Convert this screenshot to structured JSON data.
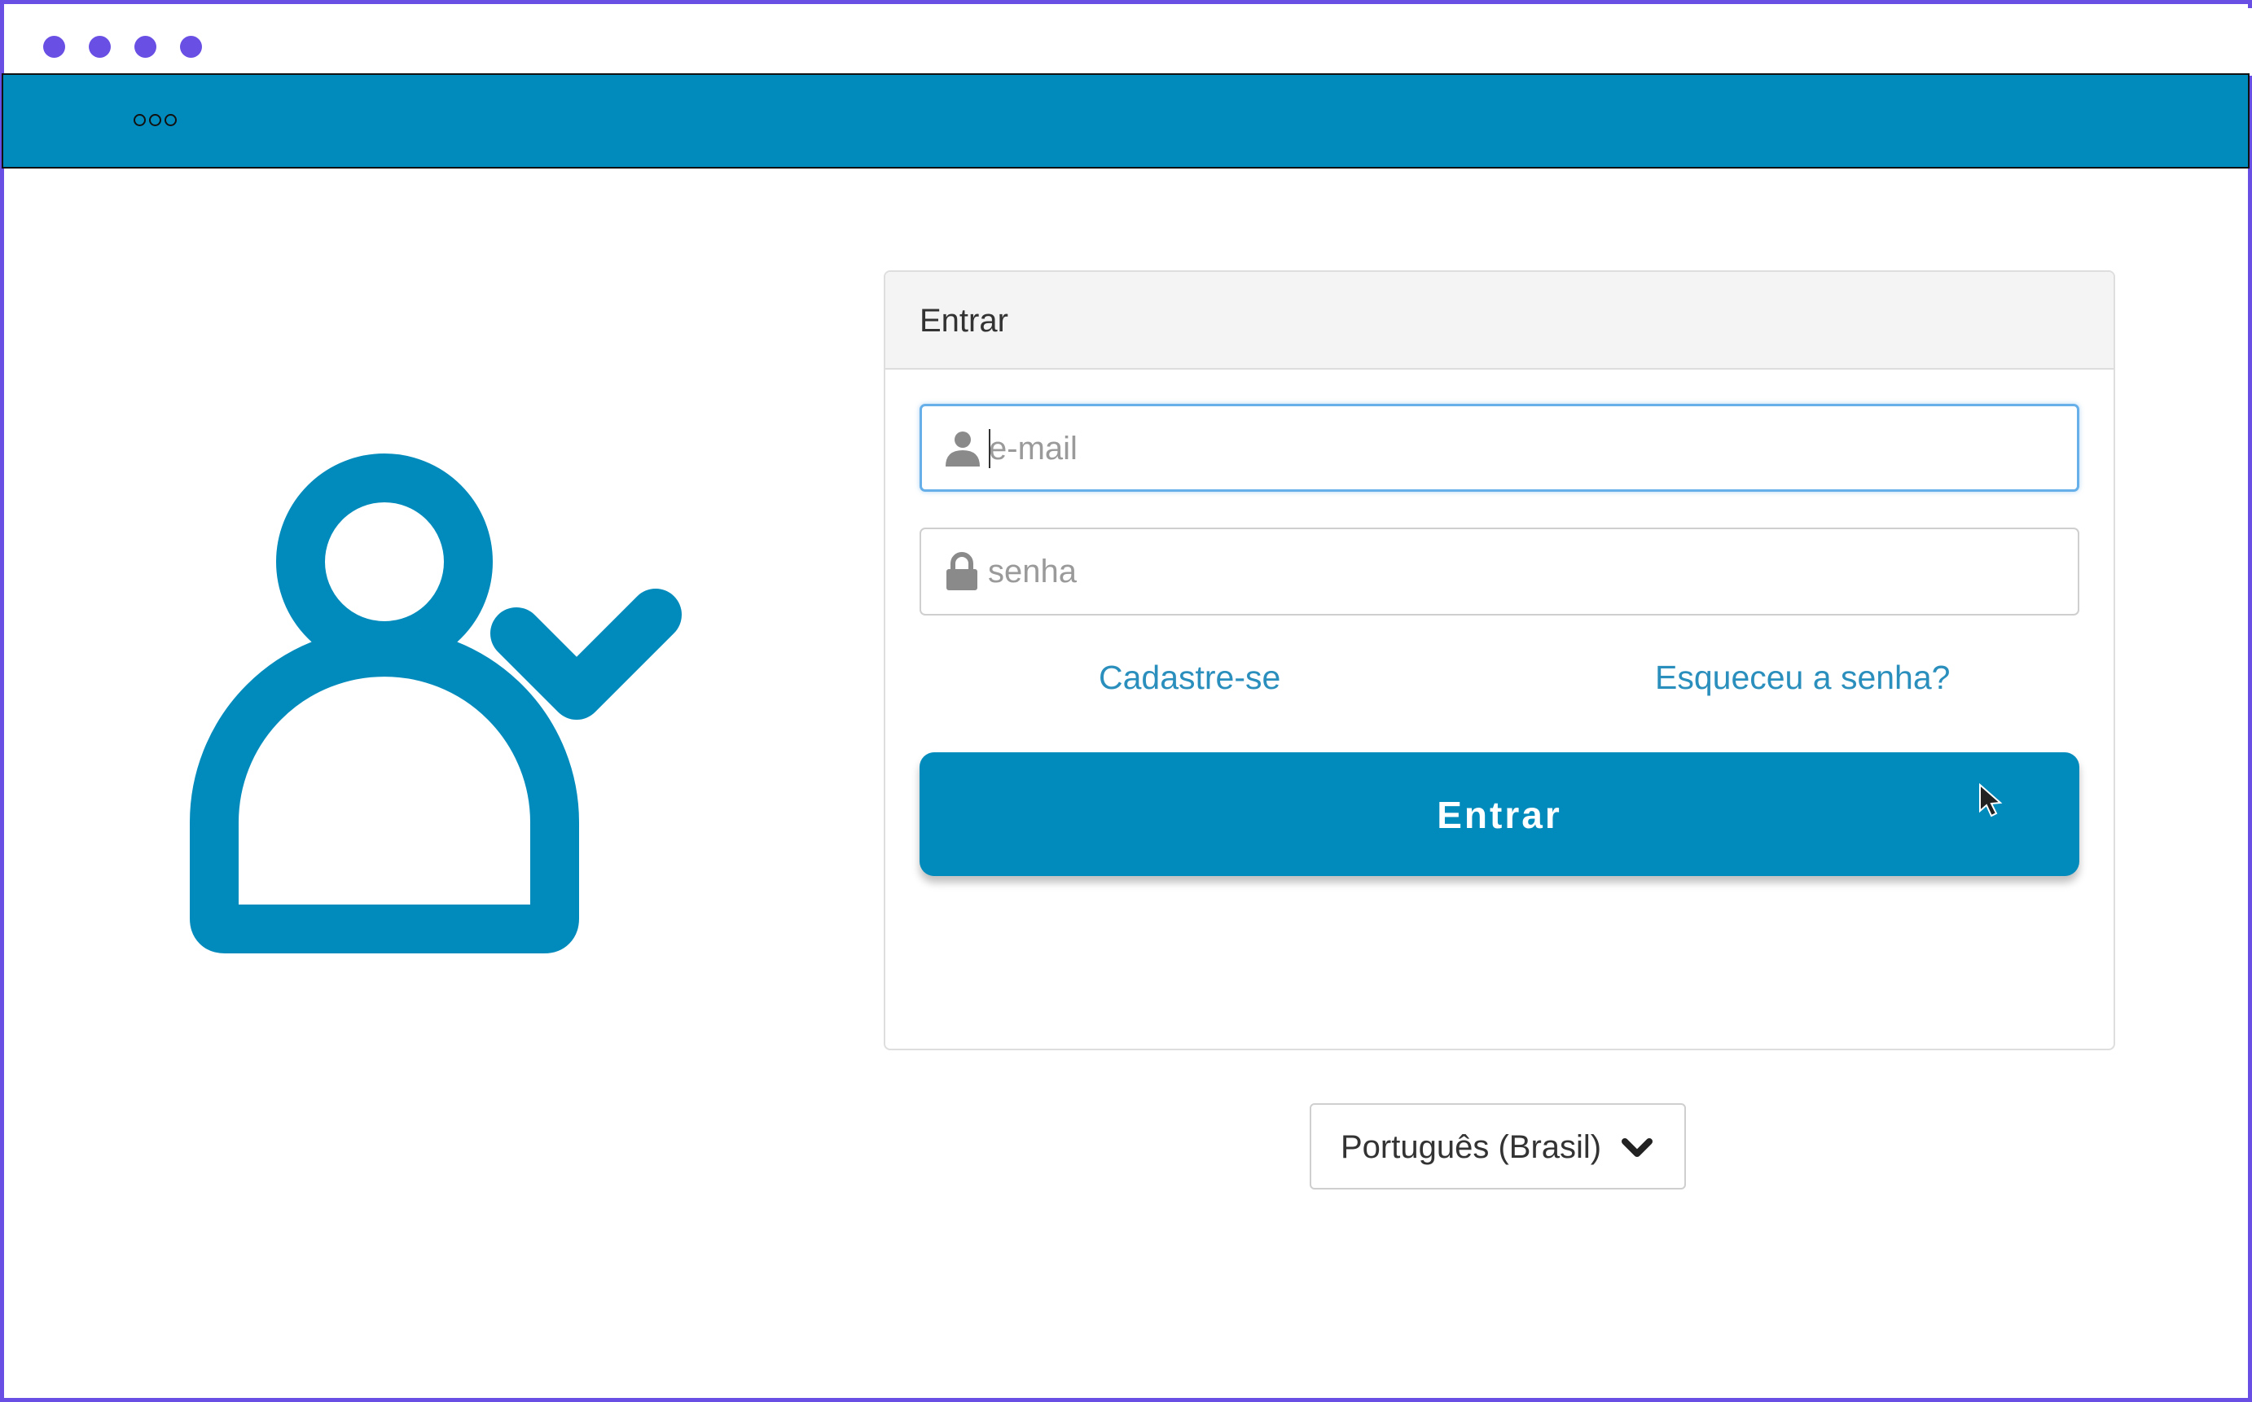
{
  "window": {
    "title_dots": [
      "dot",
      "dot",
      "dot",
      "dot"
    ],
    "accent_color": "#6a4fe4"
  },
  "appbar": {
    "menu_icon": "more-dots-icon",
    "color": "#018bbc"
  },
  "illustration": {
    "icon": "user-check-icon"
  },
  "login_card": {
    "title": "Entrar",
    "email": {
      "placeholder": "e-mail",
      "value": "",
      "icon": "user-icon"
    },
    "password": {
      "placeholder": "senha",
      "value": "",
      "icon": "lock-icon"
    },
    "register_link": "Cadastre-se",
    "forgot_link": "Esqueceu a senha?",
    "submit_label": "Entrar"
  },
  "language_select": {
    "selected": "Português (Brasil)",
    "icon": "chevron-down-icon"
  }
}
